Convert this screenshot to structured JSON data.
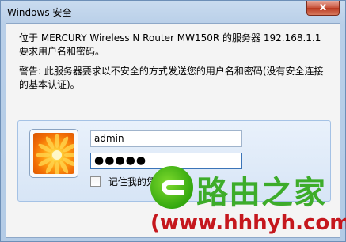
{
  "window": {
    "title": "Windows 安全",
    "close_label": "x"
  },
  "dialog": {
    "message": "位于 MERCURY Wireless N Router MW150R 的服务器 192.168.1.1 要求用户名和密码。",
    "warning": "警告: 此服务器要求以不安全的方式发送您的用户名和密码(没有安全连接的基本认证)。"
  },
  "credentials": {
    "username_value": "admin",
    "password_value": "●●●●●",
    "remember_label": "记住我的凭"
  },
  "watermark": {
    "brand": "路由之家",
    "url": "(www.hhhyh.com)"
  }
}
